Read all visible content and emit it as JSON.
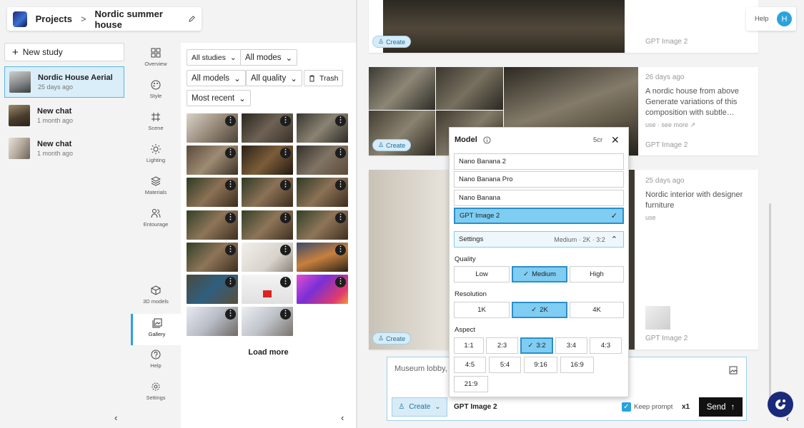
{
  "topbar": {
    "projects": "Projects",
    "separator": ">",
    "title": "Nordic summer house"
  },
  "studies": {
    "new_study": "New study",
    "items": [
      {
        "name": "Nordic House Aerial",
        "time": "25 days ago"
      },
      {
        "name": "New chat",
        "time": "1 month ago"
      },
      {
        "name": "New chat",
        "time": "1 month ago"
      }
    ]
  },
  "rail": {
    "items": [
      "Overview",
      "Style",
      "Scene",
      "Lighting",
      "Materials",
      "Entourage"
    ],
    "bottom": [
      "3D models",
      "Gallery",
      "Help",
      "Settings"
    ],
    "active": "Gallery"
  },
  "gallery": {
    "filters": {
      "studies": "All studies",
      "modes": "All modes",
      "models": "All models",
      "quality": "All quality",
      "trash": "Trash",
      "sort": "Most recent"
    },
    "more_glyph": "⋮",
    "load_more": "Load more"
  },
  "feed": [
    {
      "model": "GPT Image 2",
      "create": "Create"
    },
    {
      "time": "26 days ago",
      "description": "A nordic house from above Generate variations of this composition with subtle…",
      "use": "use",
      "see_more": "see more ↗",
      "model": "GPT Image 2",
      "create": "Create"
    },
    {
      "time": "25 days ago",
      "description": "Nordic interior with designer furniture",
      "use": "use",
      "model": "GPT Image 2",
      "create": "Create"
    }
  ],
  "help": {
    "label": "Help",
    "avatar": "H"
  },
  "model_panel": {
    "title": "Model",
    "cost": "5cr",
    "models": [
      "Nano Banana 2",
      "Nano Banana Pro",
      "Nano Banana",
      "GPT Image 2"
    ],
    "selected_model": "GPT Image 2",
    "settings_label": "Settings",
    "settings_summary": "Medium · 2K · 3:2",
    "quality_label": "Quality",
    "quality": [
      "Low",
      "Medium",
      "High"
    ],
    "quality_selected": "Medium",
    "resolution_label": "Resolution",
    "resolution": [
      "1K",
      "2K",
      "4K"
    ],
    "resolution_selected": "2K",
    "aspect_label": "Aspect",
    "aspect": [
      "1:1",
      "2:3",
      "3:2",
      "3:4",
      "4:3",
      "4:5",
      "5:4",
      "9:16",
      "16:9",
      "21:9"
    ],
    "aspect_selected": "3:2"
  },
  "prompt": {
    "text": "Museum lobby, p",
    "create": "Create",
    "model": "GPT Image 2",
    "keep_prompt": "Keep prompt",
    "keep_checked": true,
    "count": "x1",
    "send": "Send"
  },
  "colors": {
    "accent": "#2aa3dc",
    "selected": "#7fcdf2",
    "fab": "#1a2a7a"
  }
}
